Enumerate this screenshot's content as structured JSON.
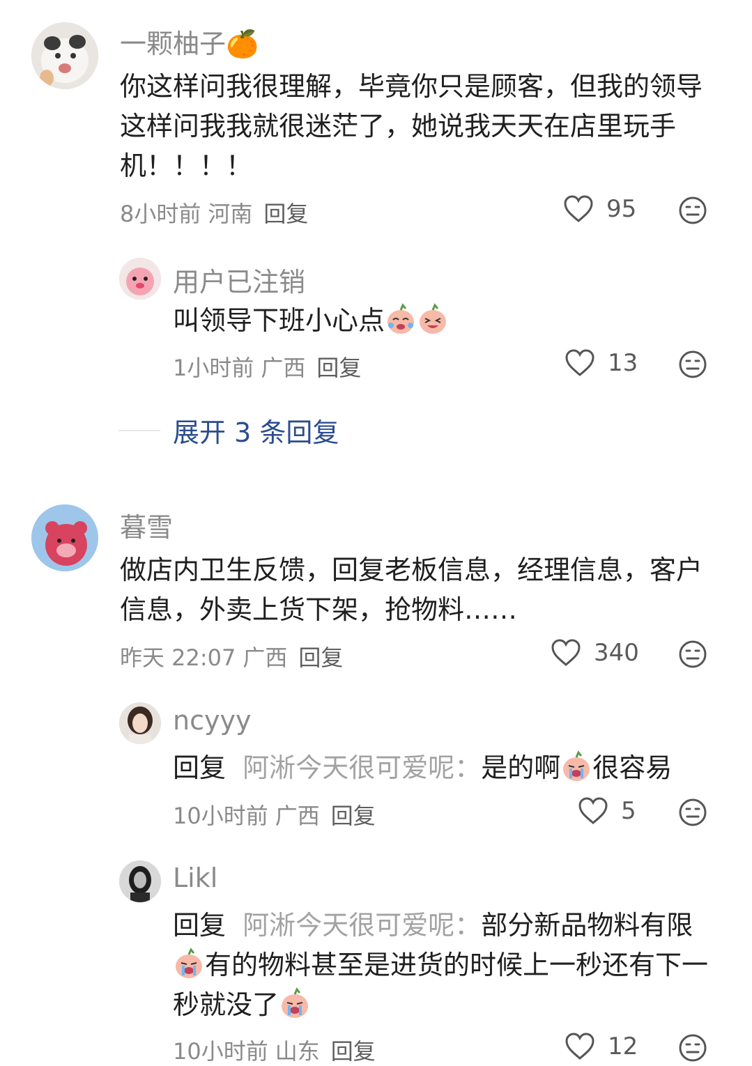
{
  "comments": [
    {
      "name": "一颗柚子",
      "name_emoji": "🍊",
      "text": "你这样问我很理解，毕竟你只是顾客，但我的领导这样问我我就很迷茫了，她说我天天在店里玩手机！！！！",
      "time": "8小时前",
      "location": "河南",
      "reply_label": "回复",
      "likes": "95",
      "replies": [
        {
          "name": "用户已注销",
          "text": "叫领导下班小心点",
          "time": "1小时前",
          "location": "广西",
          "reply_label": "回复",
          "likes": "13"
        }
      ],
      "expand_label": "展开 3 条回复"
    },
    {
      "name": "暮雪",
      "text": "做店内卫生反馈，回复老板信息，经理信息，客户信息，外卖上货下架，抢物料……",
      "time": "昨天 22:07",
      "location": "广西",
      "reply_label": "回复",
      "likes": "340",
      "replies": [
        {
          "name": "ncyyy",
          "prefix": "回复",
          "target": "阿淅今天很可爱呢：",
          "text_a": "是的啊",
          "text_b": "很容易",
          "time": "10小时前",
          "location": "广西",
          "reply_label": "回复",
          "likes": "5"
        },
        {
          "name": "Likl",
          "prefix": "回复",
          "target": "阿淅今天很可爱呢：",
          "text_a": "部分新品物料有限",
          "text_b": "有的物料甚至是进货的时候上一秒还有下一秒就没了",
          "time": "10小时前",
          "location": "山东",
          "reply_label": "回复",
          "likes": "12"
        }
      ]
    }
  ],
  "icons": {
    "like": "heart-outline-icon",
    "dislike": "meh-face-icon"
  },
  "colors": {
    "link": "#2b4d8f",
    "muted": "#8a8a8a"
  }
}
